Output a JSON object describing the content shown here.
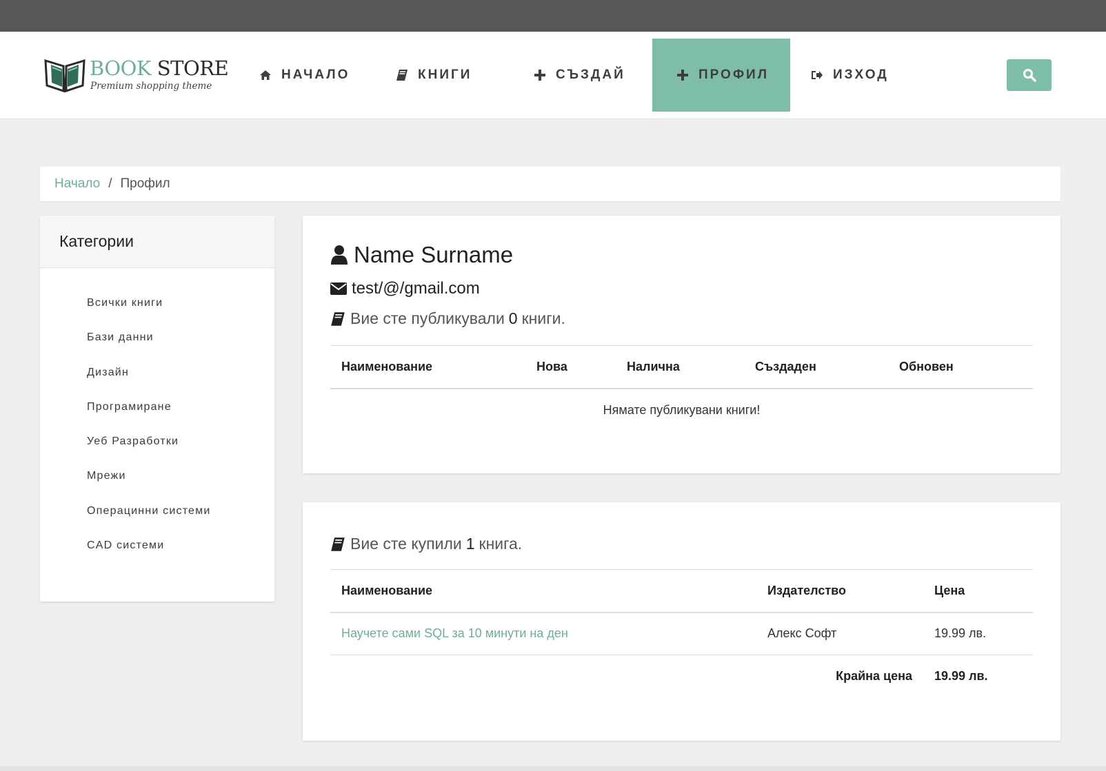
{
  "brand": {
    "title_part1": "BOOK",
    "title_part2": "STORE",
    "subtitle": "Premium shopping theme",
    "logo_icon": "open-book-icon",
    "accent_color": "#7dbda9"
  },
  "nav": {
    "home": {
      "label": "НАЧАЛО",
      "icon": "home-icon"
    },
    "books": {
      "label": "КНИГИ",
      "icon": "book-icon"
    },
    "create": {
      "label": "СЪЗДАЙ",
      "icon": "plus-icon"
    },
    "profile": {
      "label": "ПРОФИЛ",
      "icon": "plus-icon",
      "active": true
    },
    "exit": {
      "label": "ИЗХОД",
      "icon": "sign-out-icon"
    },
    "search_icon": "search-icon"
  },
  "breadcrumb": {
    "home": "Начало",
    "separator": "/",
    "current": "Профил"
  },
  "sidebar": {
    "title": "Категории",
    "items": [
      {
        "label": "Всички книги"
      },
      {
        "label": "Бази данни"
      },
      {
        "label": "Дизайн"
      },
      {
        "label": "Програмиране"
      },
      {
        "label": "Уеб Разработки"
      },
      {
        "label": "Мрежи"
      },
      {
        "label": "Операцинни системи"
      },
      {
        "label": "CAD системи"
      }
    ]
  },
  "profile": {
    "name": "Name Surname",
    "email": "test/@/gmail.com",
    "published_prefix": "Вие сте публикували",
    "published_count": "0",
    "published_suffix": "книги.",
    "published_table": {
      "headers": [
        "Наименование",
        "Нова",
        "Налична",
        "Създаден",
        "Обновен"
      ],
      "empty_message": "Нямате публикувани книги!"
    }
  },
  "orders": {
    "bought_prefix": "Вие сте купили",
    "bought_count": "1",
    "bought_suffix": "книга.",
    "headers": [
      "Наименование",
      "Издателство",
      "Цена"
    ],
    "rows": [
      {
        "title": "Научете сами SQL за 10 минути на ден",
        "publisher": "Алекс Софт",
        "price": "19.99 лв."
      }
    ],
    "total_label": "Крайна цена",
    "total_value": "19.99 лв."
  }
}
